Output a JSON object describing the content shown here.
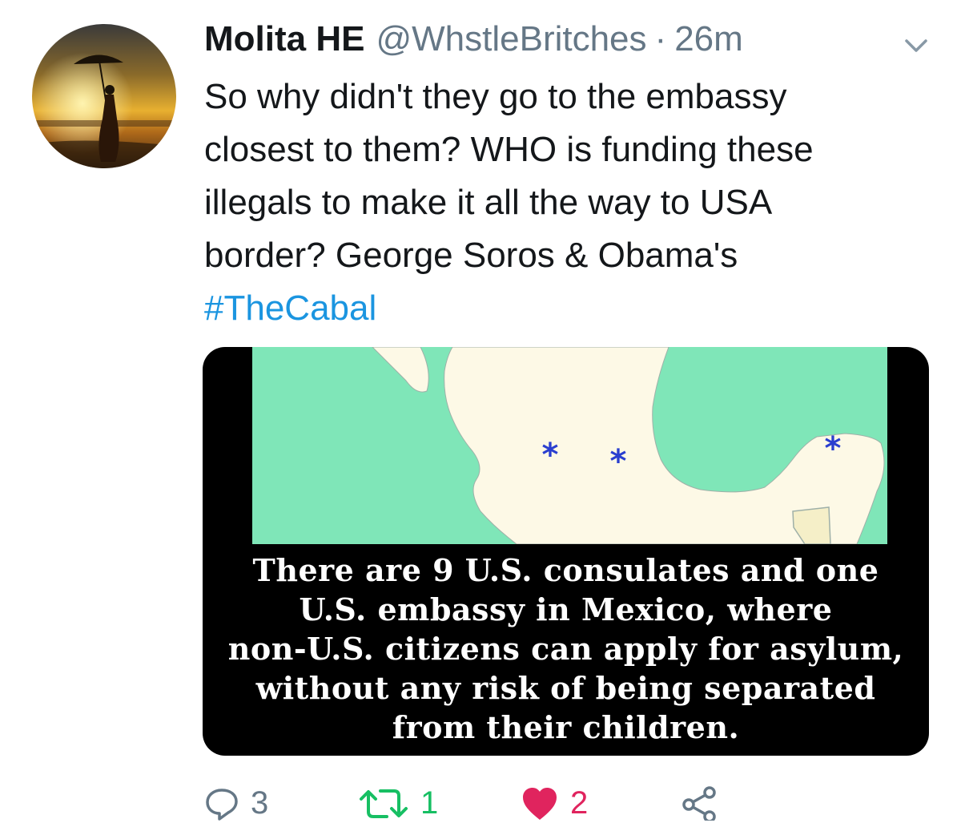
{
  "tweet": {
    "author_name": "Molita HE",
    "handle": "@WhstleBritches",
    "separator": "·",
    "time": "26m",
    "text_lines": [
      "So why didn't they go to the embassy",
      "closest to them? WHO is funding these",
      "illegals to make it all the way to USA",
      "border? George Soros & Obama's"
    ],
    "hashtag": "#TheCabal"
  },
  "media": {
    "caption_lines": [
      "There are 9 U.S. consulates and one",
      "U.S. embassy in Mexico, where",
      "non-U.S. citizens can apply for asylum,",
      "without any risk of being separated",
      "from their children."
    ],
    "map_colors": {
      "water": "#7fe6b8",
      "land": "#fdf9e6",
      "marker": "#2a3fcf"
    }
  },
  "actions": {
    "reply_count": "3",
    "retweet_count": "1",
    "like_count": "2"
  },
  "icons": {
    "avatar": "profile-photo-umbrella-silhouette",
    "chevron": "chevron-down-icon",
    "reply": "reply-icon",
    "retweet": "retweet-icon",
    "like": "heart-icon",
    "share": "share-icon"
  },
  "colors": {
    "link": "#1b95e0",
    "muted": "#657786",
    "retweet_active": "#17bf63",
    "like_active": "#e0245e"
  }
}
